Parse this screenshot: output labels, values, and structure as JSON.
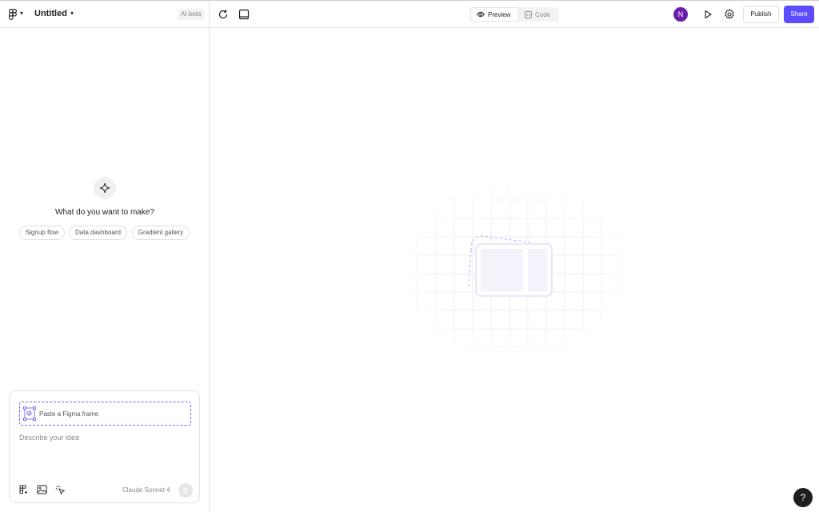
{
  "header": {
    "title": "Untitled",
    "ai_badge": "AI beta",
    "preview_tab": "Preview",
    "code_tab": "Code",
    "avatar_initial": "N",
    "publish_label": "Publish",
    "share_label": "Share"
  },
  "left_panel": {
    "prompt_title": "What do you want to make?",
    "suggestions": [
      "Signup flow",
      "Data dashboard",
      "Gradient gallery"
    ]
  },
  "composer": {
    "paste_label": "Paste a Figma frame",
    "placeholder": "Describe your idea",
    "model": "Claude Sonnet 4"
  },
  "help_label": "?",
  "colors": {
    "accent": "#5b4dff",
    "avatar": "#6a1fa8",
    "dashed_frame": "#7a5cf0"
  },
  "icons": [
    "figma-logo-icon",
    "refresh-icon",
    "layout-icon",
    "eye-icon",
    "code-icon",
    "play-icon",
    "gear-icon",
    "sparkle-icon",
    "figma-frame-icon",
    "figma-insert-icon",
    "image-icon",
    "select-cursor-icon",
    "arrow-up-icon"
  ]
}
